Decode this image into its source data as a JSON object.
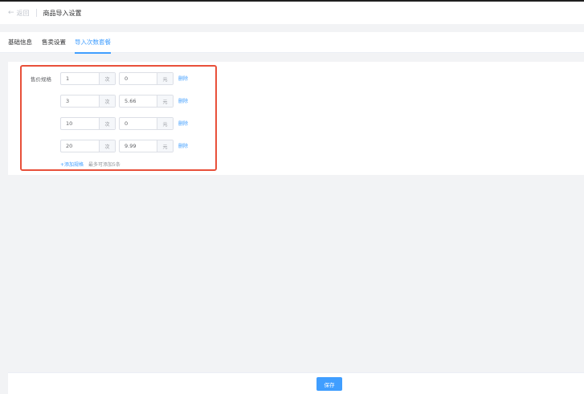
{
  "header": {
    "back_label": "返回",
    "title": "商品导入设置"
  },
  "tabs": [
    {
      "label": "基础信息",
      "active": false
    },
    {
      "label": "售卖设置",
      "active": false
    },
    {
      "label": "导入次数套餐",
      "active": true
    }
  ],
  "form": {
    "label": "售价规格",
    "rows": [
      {
        "times": "1",
        "times_unit": "次",
        "price": "0",
        "price_unit": "元",
        "delete_label": "删除"
      },
      {
        "times": "3",
        "times_unit": "次",
        "price": "5.66",
        "price_unit": "元",
        "delete_label": "删除"
      },
      {
        "times": "10",
        "times_unit": "次",
        "price": "0",
        "price_unit": "元",
        "delete_label": "删除"
      },
      {
        "times": "20",
        "times_unit": "次",
        "price": "9.99",
        "price_unit": "元",
        "delete_label": "删除"
      }
    ],
    "add_label": "+添加规格",
    "add_hint": "最多可添加5条"
  },
  "footer": {
    "save_label": "保存"
  },
  "colors": {
    "accent": "#409eff",
    "highlight": "#e8503a"
  },
  "icons": {
    "back": "arrow-left-icon"
  }
}
